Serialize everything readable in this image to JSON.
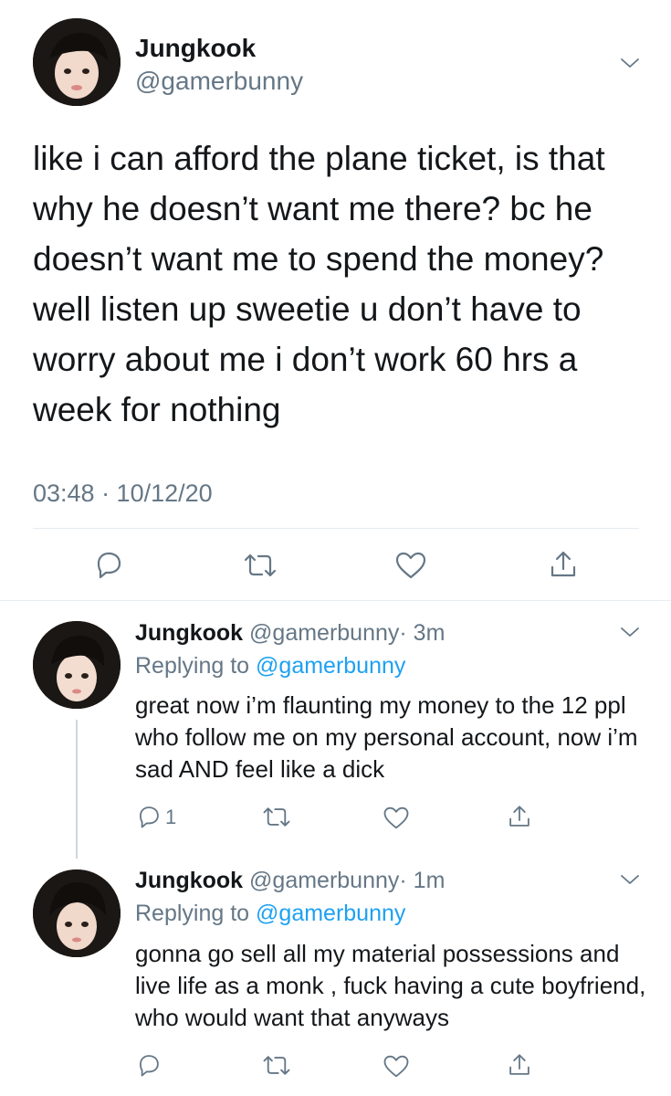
{
  "main_tweet": {
    "display_name": "Jungkook",
    "handle": "@gamerbunny",
    "text": "like i can afford the plane ticket, is that why he doesn’t want me there? bc he doesn’t want me to spend the money? well listen up sweetie u don’t have to worry about me i don’t work 60 hrs a week for nothing",
    "timestamp": "03:48 · 10/12/20",
    "actions": [
      "reply-icon",
      "retweet-icon",
      "like-icon",
      "share-icon"
    ]
  },
  "replies": [
    {
      "display_name": "Jungkook",
      "handle": "@gamerbunny",
      "time": "· 3m",
      "replying_label": "Replying to",
      "replying_to": "@gamerbunny",
      "text": "great now i’m flaunting my money to the 12 ppl who follow me on my personal account, now i’m sad AND feel like a dick",
      "reply_count": "1"
    },
    {
      "display_name": "Jungkook",
      "handle": "@gamerbunny",
      "time": "· 1m",
      "replying_label": "Replying to",
      "replying_to": "@gamerbunny",
      "text": "gonna go sell all my material possessions and live life as a monk , fuck having a cute boyfriend, who would want that anyways",
      "reply_count": ""
    }
  ],
  "colors": {
    "accent": "#1da1f2",
    "muted": "#657786",
    "text": "#14171a",
    "divider": "#e6ecf0"
  }
}
